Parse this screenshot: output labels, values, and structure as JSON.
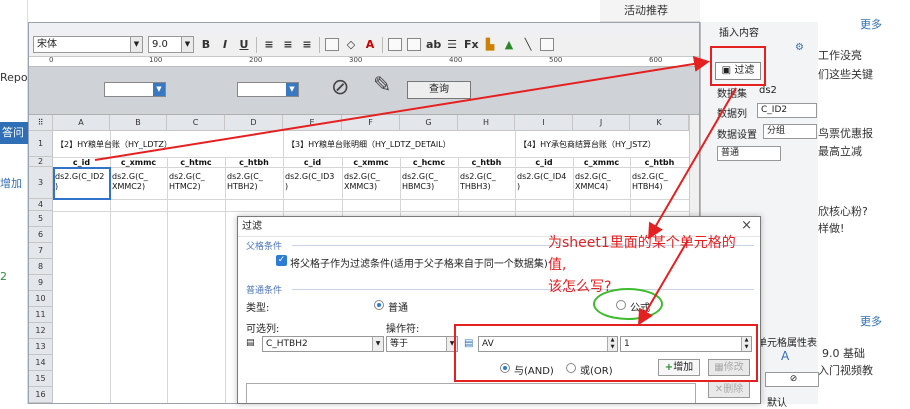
{
  "background": {
    "left_texts": [
      "Repo",
      "答问",
      "增加",
      "2"
    ],
    "top_tab": "活动推荐",
    "right_items": [
      {
        "text": "更多",
        "more": true
      },
      {
        "text": "工作没亮",
        "more": false
      },
      {
        "text": "们这些关键",
        "more": false
      },
      {
        "text": "鸟票优惠报",
        "more": false
      },
      {
        "text": "最高立减",
        "more": false
      },
      {
        "text": "欣核心粉?",
        "more": false
      },
      {
        "text": "样做!",
        "more": false
      },
      {
        "text": "更多",
        "more": true
      },
      {
        "text": "9.0 基础",
        "more": false
      },
      {
        "text": "入门视频教",
        "more": false
      }
    ]
  },
  "toolbar": {
    "font": "宋体",
    "size": "9.0",
    "bold": "B",
    "italic": "I",
    "underline": "U",
    "text_color_label": "A"
  },
  "ruler": [
    "0",
    "100",
    "200",
    "300",
    "400",
    "500",
    "600"
  ],
  "param_area": {
    "query_button": "查询"
  },
  "grid": {
    "columns": [
      "A",
      "B",
      "C",
      "D",
      "E",
      "F",
      "G",
      "H",
      "I",
      "J",
      "K"
    ],
    "rows": [
      "1",
      "2",
      "3",
      "4",
      "5",
      "6",
      "7",
      "8",
      "9",
      "10",
      "11",
      "12",
      "13",
      "14",
      "15",
      "16"
    ],
    "titles": [
      "【2】HY粮单台账（HY_LDTZ）",
      "【3】HY粮单台账明细（HY_LDTZ_DETAIL）",
      "【4】HY承包商结算台账（HY_JSTZ）"
    ],
    "headers": [
      "c_id",
      "c_xmmc",
      "c_htmc",
      "c_htbh",
      "c_id",
      "c_xmmc",
      "c_hcmc",
      "c_htbh",
      "c_id",
      "c_xmmc",
      "c_htbh"
    ],
    "cells": [
      "ds2.G(C_ID2\n)",
      "ds2.G(C_\nXMMC2)",
      "ds2.G(C_\nHTMC2)",
      "ds2.G(C_\nHTBH2)",
      "ds2.G(C_ID3\n)",
      "ds2.G(C_\nXMMC3)",
      "ds2.G(C_\nHBMC3)",
      "ds2.G(C_\nTHBH3)",
      "ds2.G(C_ID4\n)",
      "ds2.G(C_\nXMMC4)",
      "ds2.G(C_\nHTBH4)"
    ]
  },
  "props": {
    "insert_label": "插入内容",
    "filter_button": "过滤",
    "dataset_label": "数据集",
    "dataset_value": "ds2",
    "column_label": "数据列",
    "column_value": "C_ID2",
    "setting_label": "数据设置",
    "setting_value": "分组",
    "mode_value": "普通",
    "cell_attr_label": "单元格属性表",
    "style_label": "默认"
  },
  "dialog": {
    "title": "过滤",
    "parent_section": "父格条件",
    "parent_checkbox_label": "将父格子作为过滤条件(适用于父子格来自于同一个数据集)",
    "normal_section": "普通条件",
    "type_label": "类型:",
    "radio_normal": "普通",
    "radio_formula": "公式",
    "optional_col_label": "可选列:",
    "operator_label": "操作符:",
    "column_value": "C_HTBH2",
    "operator_value": "等于",
    "value_input": "AV",
    "number_input": "1",
    "and_label": "与(AND)",
    "or_label": "或(OR)",
    "add_button": "增加",
    "modify_button": "修改",
    "delete_button": "删除"
  },
  "annotation": {
    "line1": "为sheet1里面的某个单元格的",
    "line2": "值,",
    "line3": "该怎么写?"
  }
}
